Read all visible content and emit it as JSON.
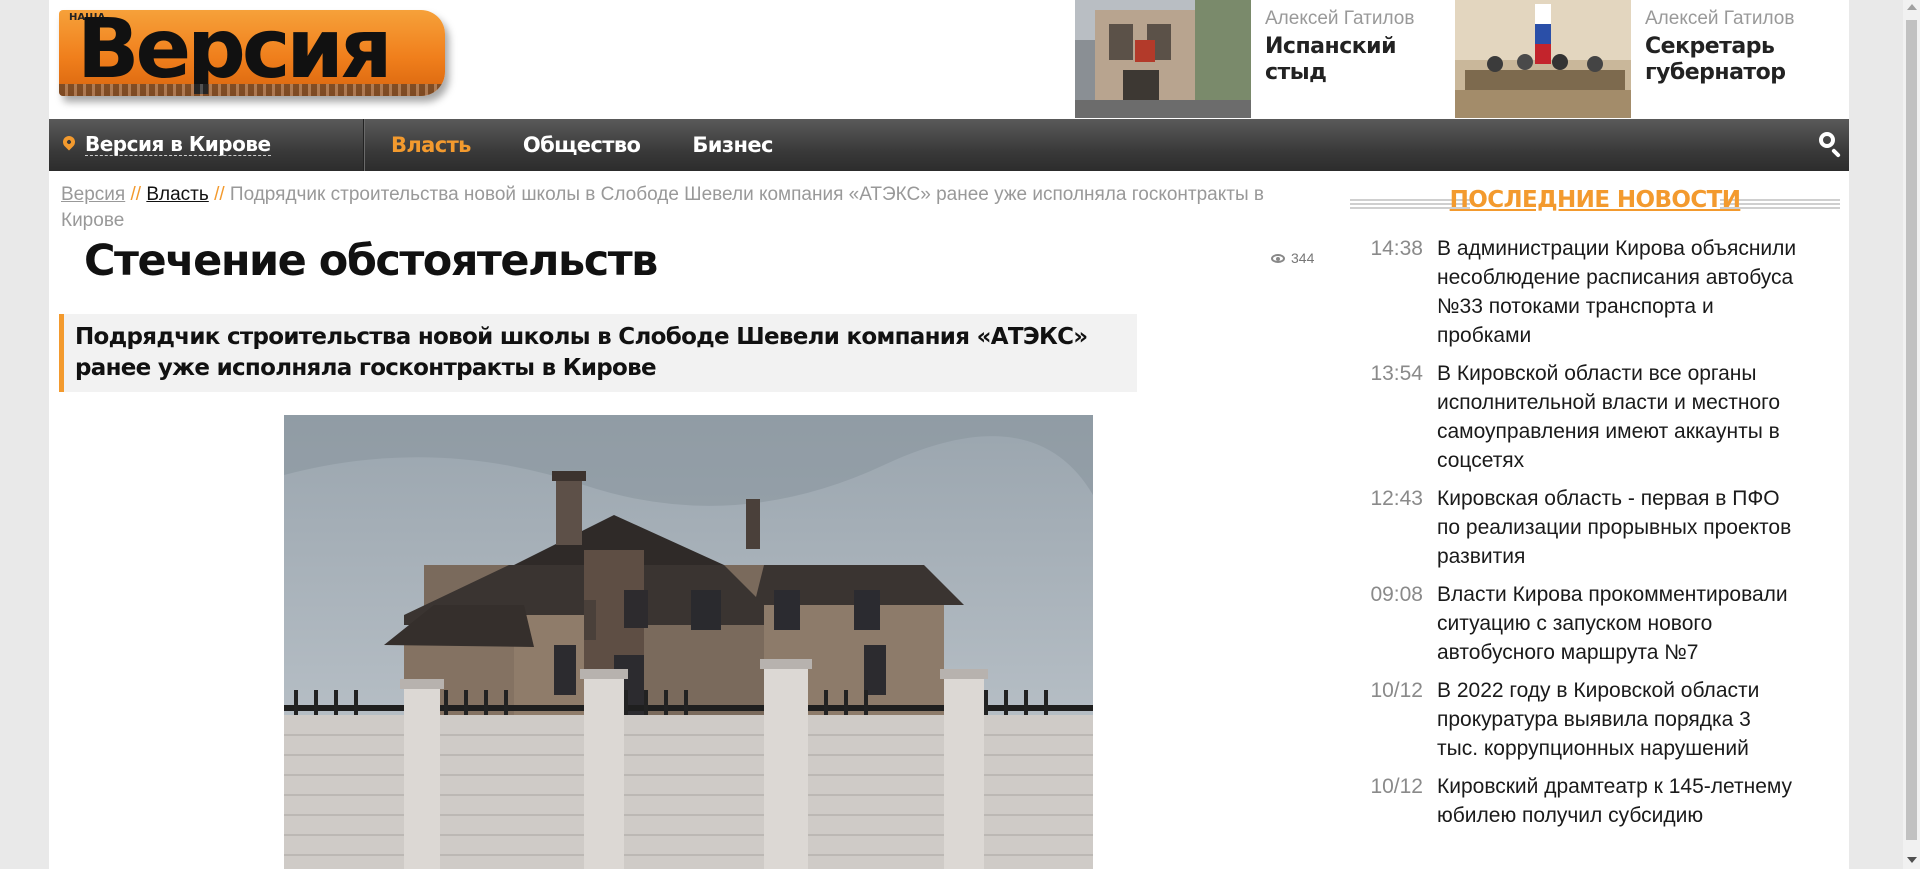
{
  "site": {
    "logo_text": "Версия",
    "logo_tag": "НАША"
  },
  "promos": [
    {
      "author": "Алексей Гатилов",
      "title": "Испанский стыд",
      "image": "building-photo"
    },
    {
      "author": "Алексей Гатилов",
      "title": "Секретарь губернатор",
      "image": "meeting-photo"
    }
  ],
  "nav": {
    "location": "Версия в Кирове",
    "items": [
      "Власть",
      "Общество",
      "Бизнес"
    ],
    "active_index": 0,
    "search_icon": "search-icon"
  },
  "breadcrumb": {
    "home": "Версия",
    "section": "Власть",
    "separator": "//",
    "current": "Подрядчик строительства новой школы в Слободе Шевели компания «АТЭКС» ранее уже исполняла госконтракты в Кирове"
  },
  "article": {
    "title": "Стечение обстоятельств",
    "views": "344",
    "lead": "Подрядчик строительства новой школы в Слободе Шевели компания «АТЭКС» ранее уже исполняла госконтракты в Кирове",
    "image": "house-photo"
  },
  "sidebar": {
    "title": "ПОСЛЕДНИЕ НОВОСТИ",
    "news": [
      {
        "time": "14:38",
        "text": "В администрации Кирова объяснили несоблюдение расписания автобуса №33 потоками транспорта и пробками"
      },
      {
        "time": "13:54",
        "text": "В Кировской области все органы исполнительной власти и местного самоуправления имеют аккаунты в соцсетях"
      },
      {
        "time": "12:43",
        "text": "Кировская область - первая в ПФО по реализации прорывных проектов развития"
      },
      {
        "time": "09:08",
        "text": "Власти Кирова прокомментировали ситуацию с запуском нового автобусного маршрута №7"
      },
      {
        "time": "10/12",
        "text": "В 2022 году в Кировской области прокуратура выявила порядка 3 тыс. коррупционных нарушений"
      },
      {
        "time": "10/12",
        "text": "Кировский драмтеатр к 145-летнему юбилею получил субсидию"
      }
    ]
  },
  "colors": {
    "accent": "#f39a2e",
    "nav_dark": "#3a3a3a"
  }
}
